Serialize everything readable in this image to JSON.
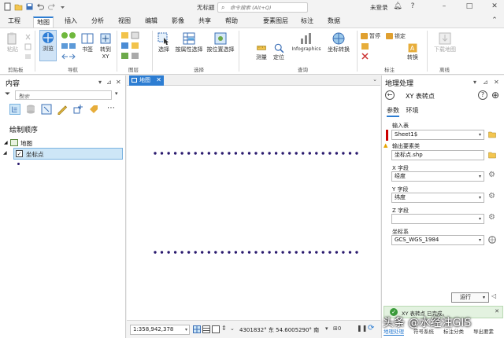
{
  "app": {
    "title": "无标题",
    "search_placeholder": "命令搜索 (Alt+Q)",
    "user": "未登录",
    "accent": "#2d7dd2"
  },
  "ribbon_tabs": [
    "工程",
    "地图",
    "插入",
    "分析",
    "视图",
    "编辑",
    "影像",
    "共享",
    "帮助",
    "要素图层",
    "标注",
    "数据"
  ],
  "active_tab": "地图",
  "contextual_group": "要素图层",
  "ribbon": {
    "clipboard": {
      "paste": "粘贴",
      "group": "剪贴板"
    },
    "navigate": {
      "explore": "浏览",
      "bookmarks": "书签",
      "goto_xy": "转到 XY",
      "group": "导航"
    },
    "layer": {
      "group": "图层"
    },
    "selection": {
      "select": "选择",
      "by_attr": "按属性选择",
      "by_loc": "按位置选择",
      "group": "选择"
    },
    "inquiry": {
      "measure": "测量",
      "locate": "定位",
      "infographics": "Infographics",
      "coord_convert": "坐标转换",
      "group": "查询"
    },
    "labeling": {
      "pause": "暂停",
      "lock": "锁定",
      "convert": "转换",
      "group": "标注"
    },
    "offline": {
      "download": "下载地图",
      "group": "离线"
    }
  },
  "contents_pane": {
    "title": "内容",
    "search_placeholder": "搜索",
    "drawing_order": "绘制顺序",
    "map_item": "地图",
    "layer_item": "坐标点"
  },
  "map_view": {
    "tab_label": "地图",
    "scale": "1:358,942,378",
    "coordinates": "4301832° 东  54.6005290° 南"
  },
  "map_points": {
    "row_count": 2,
    "points_per_row": 31,
    "point_color": "#2a1a6e"
  },
  "geoprocessing": {
    "title": "地理处理",
    "tool_name": "XY 表转点",
    "tabs": [
      "参数",
      "环境"
    ],
    "active_tab": "参数",
    "fields": [
      {
        "label": "输入表",
        "value": "Sheet1$"
      },
      {
        "label": "输出要素类",
        "value": "坐标点.shp"
      },
      {
        "label": "X 字段",
        "value": "经度"
      },
      {
        "label": "Y 字段",
        "value": "纬度"
      },
      {
        "label": "Z 字段",
        "value": ""
      },
      {
        "label": "坐标系",
        "value": "GCS_WGS_1984"
      }
    ],
    "run_label": "运行",
    "done_message": "XY 表转点 已完成。",
    "bottom_tabs": [
      "地理处理",
      "符号系统",
      "标注分类",
      "导出要素"
    ]
  },
  "watermark": "头条 @水经注GIS"
}
